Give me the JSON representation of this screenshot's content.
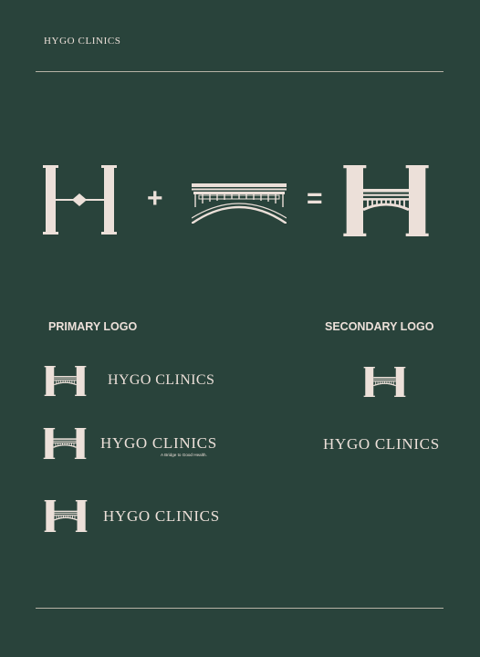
{
  "brand": {
    "name": "HYGO CLINICS"
  },
  "equation": {
    "plus": "+",
    "equals": "=",
    "parts": [
      "h-letter-icon",
      "bridge-icon"
    ],
    "result": "h-bridge-logo-icon"
  },
  "primary": {
    "heading": "PRIMARY LOGO",
    "variants": [
      {
        "wordmark": "HYGO CLINICS"
      },
      {
        "wordmark": "HYGO CLINICS",
        "tagline": "A Bridge to Good Health."
      },
      {
        "wordmark": "HYGO CLINICS"
      }
    ]
  },
  "secondary": {
    "heading": "SECONDARY LOGO",
    "wordmark": "HYGO CLINICS"
  },
  "colors": {
    "background": "#29433b",
    "ink": "#ece0d9",
    "rule": "#b7b3a6"
  }
}
